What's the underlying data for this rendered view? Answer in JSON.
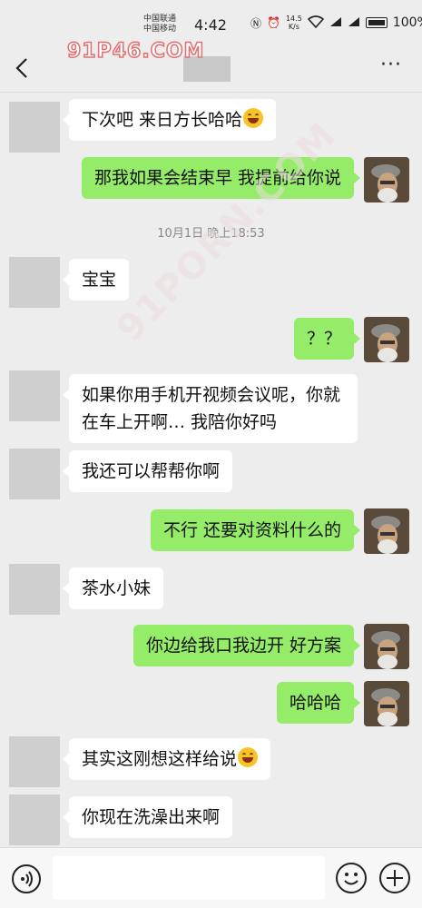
{
  "status_bar": {
    "carrier_1": "中国联通",
    "carrier_2": "中国移动",
    "time": "4:42",
    "net_speed_value": "14.5",
    "net_speed_unit": "K/s",
    "battery": "100%"
  },
  "header": {
    "watermark": "91P46.COM",
    "diagonal_watermark": "91PORN.COM",
    "more_label": "···"
  },
  "timestamp": "10月1日 晚上18:53",
  "messages": [
    {
      "side": "left",
      "text": "下次吧 来日方长哈哈"
    },
    {
      "side": "right",
      "text": "那我如果会结束早 我提前给你说"
    },
    {
      "side": "left",
      "text": "宝宝"
    },
    {
      "side": "right",
      "text": "？？"
    },
    {
      "side": "left",
      "text": "如果你用手机开视频会议呢，你就在车上开啊… 我陪你好吗"
    },
    {
      "side": "left",
      "text": "我还可以帮帮你啊"
    },
    {
      "side": "right",
      "text": "不行 还要对资料什么的"
    },
    {
      "side": "left",
      "text": "茶水小妹"
    },
    {
      "side": "right",
      "text": "你边给我口我边开 好方案"
    },
    {
      "side": "right",
      "text": "哈哈哈"
    },
    {
      "side": "left",
      "text": "其实这刚想这样给说"
    },
    {
      "side": "left",
      "text": "你现在洗澡出来啊"
    }
  ],
  "input": {
    "placeholder": ""
  },
  "colors": {
    "sent_bubble": "#95ec69",
    "received_bubble": "#ffffff",
    "background": "#ededed"
  }
}
